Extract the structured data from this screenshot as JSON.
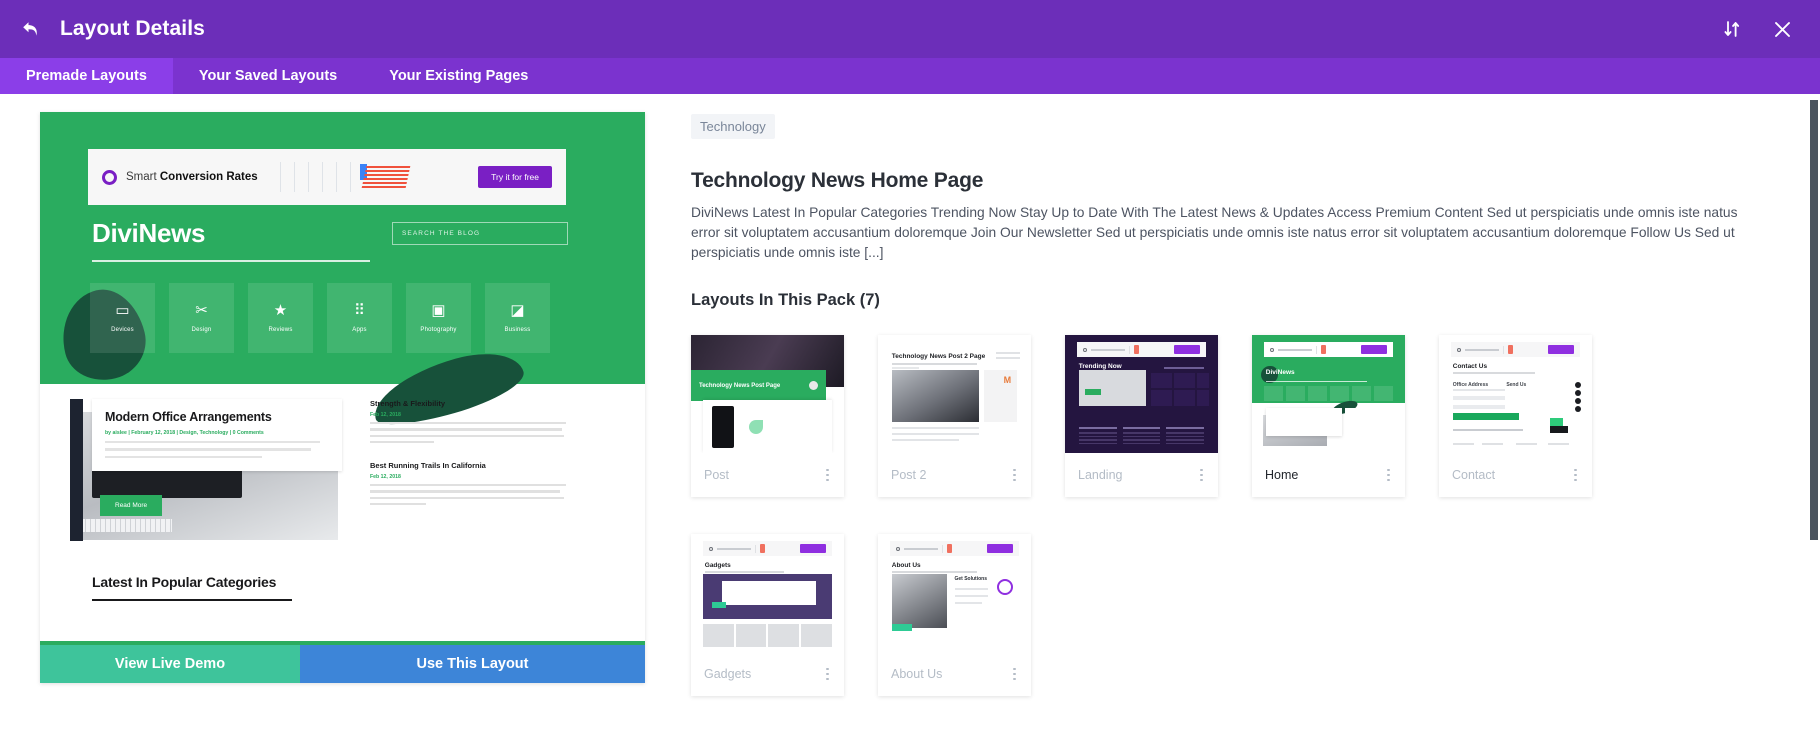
{
  "header": {
    "title": "Layout Details",
    "back_icon": "back-arrow-icon",
    "sort_icon": "sort-updown-icon",
    "close_icon": "close-x-icon",
    "bg_color": "#6c2eb9"
  },
  "tabs": [
    {
      "label": "Premade Layouts",
      "active": true
    },
    {
      "label": "Your Saved Layouts",
      "active": false
    },
    {
      "label": "Your Existing Pages",
      "active": false
    }
  ],
  "preview": {
    "demo_button": "View Live Demo",
    "use_button": "Use This Layout",
    "demo_color": "#3ec49b",
    "use_color": "#3d85d8",
    "site": {
      "ad_text_light": "Smart ",
      "ad_text_bold": "Conversion Rates",
      "ad_button": "Try it for free",
      "brand": "DiviNews",
      "search_placeholder": "SEARCH THE BLOG",
      "tiles": [
        {
          "label": "Devices",
          "icon": "monitor-icon",
          "glyph": "▭"
        },
        {
          "label": "Design",
          "icon": "design-tools-icon",
          "glyph": "✂"
        },
        {
          "label": "Reviews",
          "icon": "star-half-icon",
          "glyph": "★"
        },
        {
          "label": "Apps",
          "icon": "grid-apps-icon",
          "glyph": "∷"
        },
        {
          "label": "Photography",
          "icon": "image-icon",
          "glyph": "Ὓc"
        },
        {
          "label": "Business",
          "icon": "building-icon",
          "glyph": "◧"
        }
      ],
      "post_title": "Modern Office Arrangements",
      "post_meta": "by aislee | February 12, 2018 | Design, Technology | 0 Comments",
      "read_more": "Read More",
      "side_posts": [
        {
          "title": "Strength & Flexibility",
          "date": "Feb 12, 2018"
        },
        {
          "title": "Best Running Trails In California",
          "date": "Feb 12, 2018"
        }
      ],
      "categories_heading": "Latest In Popular Categories"
    }
  },
  "details": {
    "category": "Technology",
    "title": "Technology News Home Page",
    "description": "DiviNews Latest In Popular Categories Trending Now Stay Up to Date With The Latest News & Updates Access Premium Content Sed ut perspiciatis unde omnis iste natus error sit voluptatem accusantium doloremque Join Our Newsletter Sed ut perspiciatis unde omnis iste natus error sit voluptatem accusantium doloremque Follow Us Sed ut perspiciatis unde omnis iste [...]",
    "pack_heading": "Layouts In This Pack (7)"
  },
  "layouts": [
    {
      "name": "Post",
      "active": false,
      "menu_icon": "more-vertical-icon"
    },
    {
      "name": "Post 2",
      "active": false,
      "menu_icon": "more-vertical-icon"
    },
    {
      "name": "Landing",
      "active": false,
      "menu_icon": "more-vertical-icon"
    },
    {
      "name": "Home",
      "active": true,
      "menu_icon": "more-vertical-icon"
    },
    {
      "name": "Contact",
      "active": false,
      "menu_icon": "more-vertical-icon"
    },
    {
      "name": "Gadgets",
      "active": false,
      "menu_icon": "more-vertical-icon"
    },
    {
      "name": "About Us",
      "active": false,
      "menu_icon": "more-vertical-icon"
    }
  ],
  "scrollbar": {
    "color": "#4a545f"
  }
}
